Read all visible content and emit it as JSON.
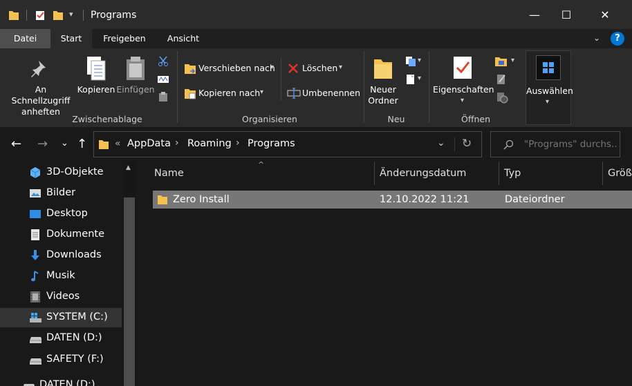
{
  "window": {
    "title": "Programs",
    "minimize": "—",
    "maximize": "☐",
    "close": "✕"
  },
  "tabs": [
    {
      "label": "Datei"
    },
    {
      "label": "Start"
    },
    {
      "label": "Freigeben"
    },
    {
      "label": "Ansicht"
    }
  ],
  "ribbon": {
    "pin": "An Schnellzugriff anheften",
    "copy": "Kopieren",
    "paste": "Einfügen",
    "group_clipboard": "Zwischenablage",
    "move_to": "Verschieben nach",
    "copy_to": "Kopieren nach",
    "delete": "Löschen",
    "rename": "Umbenennen",
    "group_organize": "Organisieren",
    "new_folder": "Neuer Ordner",
    "group_new": "Neu",
    "properties": "Eigenschaften",
    "group_open": "Öffnen",
    "select": "Auswählen",
    "help": "?"
  },
  "address": {
    "chevron": "«",
    "crumbs": [
      "AppData",
      "Roaming",
      "Programs"
    ],
    "search_placeholder": "\"Programs\" durchs..."
  },
  "sidebar": {
    "items": [
      {
        "label": "3D-Objekte",
        "icon": "3d-objects-icon"
      },
      {
        "label": "Bilder",
        "icon": "pictures-icon"
      },
      {
        "label": "Desktop",
        "icon": "desktop-icon"
      },
      {
        "label": "Dokumente",
        "icon": "documents-icon"
      },
      {
        "label": "Downloads",
        "icon": "downloads-icon"
      },
      {
        "label": "Musik",
        "icon": "music-icon"
      },
      {
        "label": "Videos",
        "icon": "videos-icon"
      },
      {
        "label": "SYSTEM (C:)",
        "icon": "drive-c-icon"
      },
      {
        "label": "DATEN (D:)",
        "icon": "drive-icon"
      },
      {
        "label": "SAFETY (F:)",
        "icon": "drive-icon"
      },
      {
        "label": "DATEN (D:)",
        "icon": "drive-icon"
      }
    ]
  },
  "columns": [
    {
      "label": "Name"
    },
    {
      "label": "Änderungsdatum"
    },
    {
      "label": "Typ"
    },
    {
      "label": "Größ"
    }
  ],
  "rows": [
    {
      "name": "Zero Install",
      "date": "12.10.2022 11:21",
      "type": "Dateiordner"
    }
  ],
  "colors": {
    "accent": "#0078d7",
    "folder": "#f4c04f",
    "selected_row": "#777777"
  }
}
